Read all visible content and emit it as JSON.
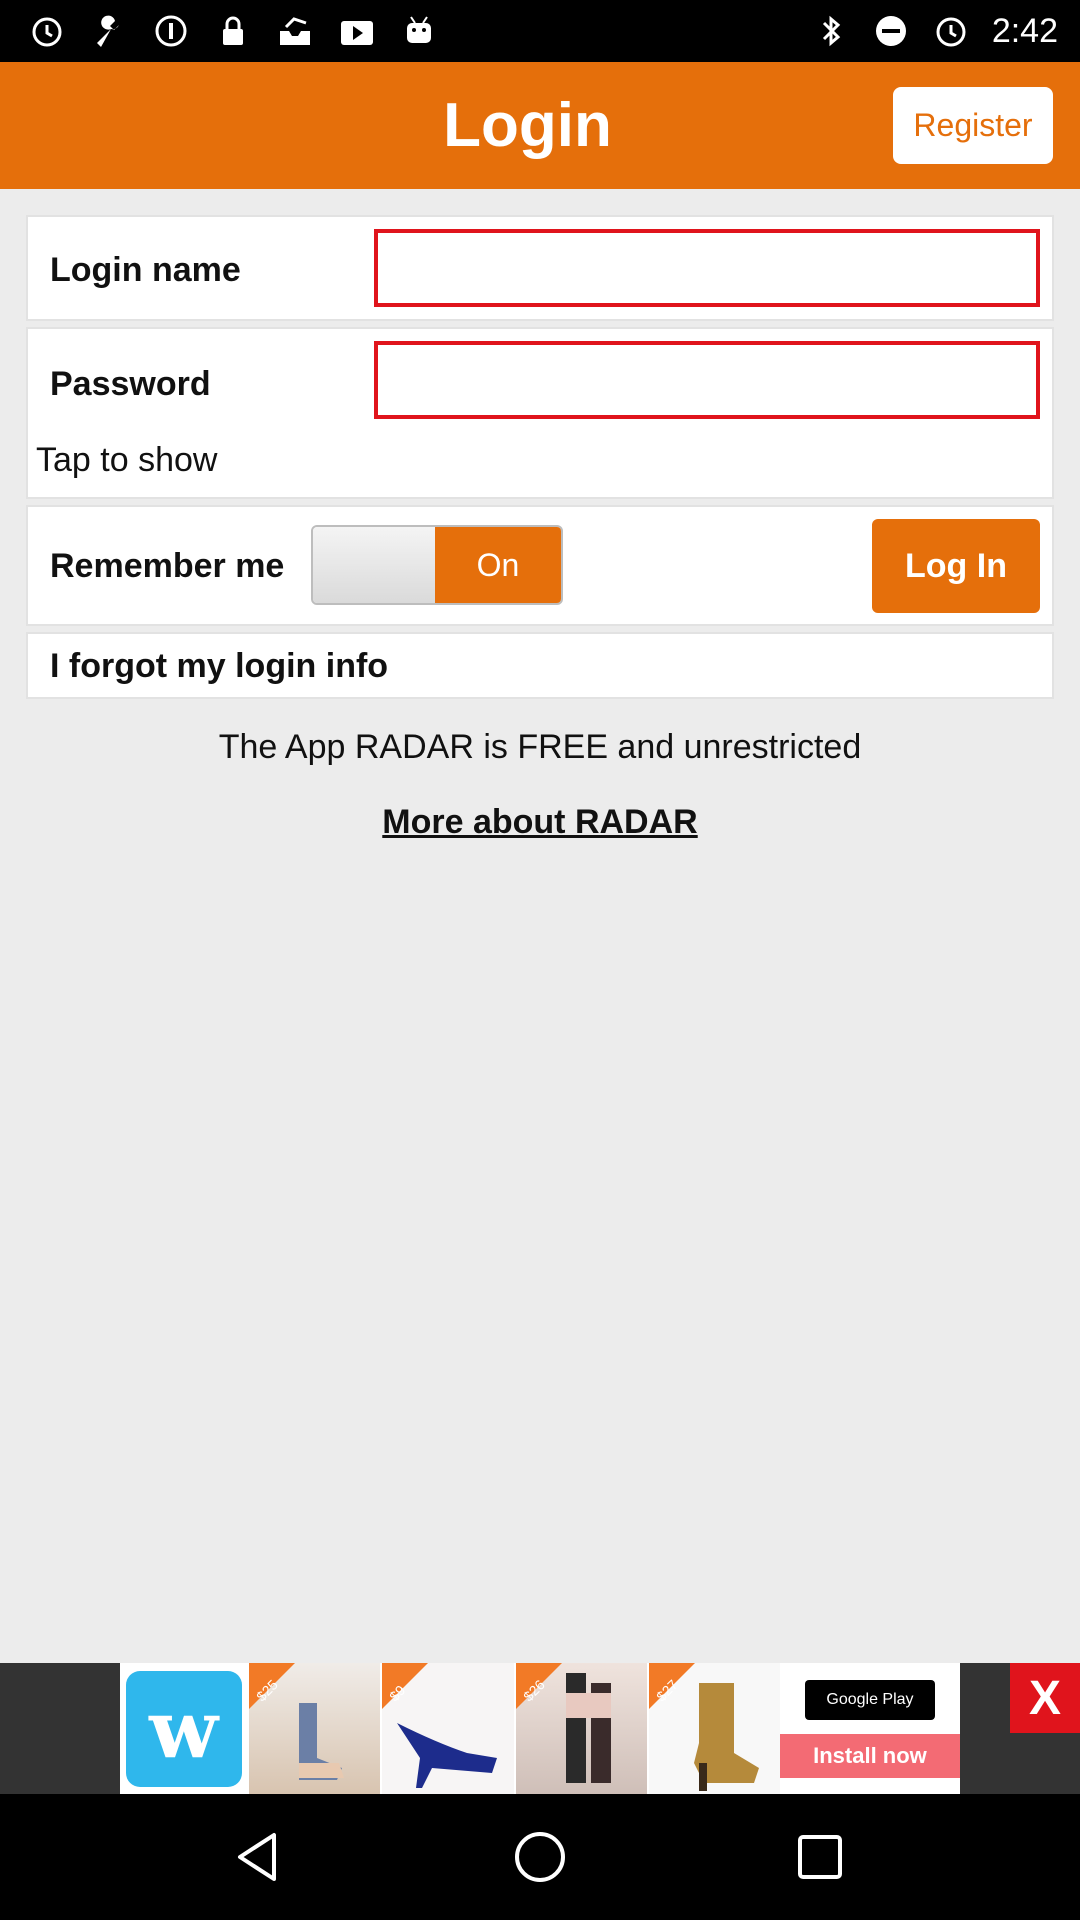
{
  "status_bar": {
    "time": "2:42",
    "left_icons": [
      "alarm-icon",
      "wrench-icon",
      "info-icon",
      "lock-icon",
      "inbox-icon",
      "play-icon",
      "android-icon"
    ],
    "right_icons": [
      "bluetooth-icon",
      "dnd-icon",
      "alarm-icon"
    ]
  },
  "app_bar": {
    "title": "Login",
    "register_label": "Register"
  },
  "form": {
    "login_name_label": "Login name",
    "login_name_value": "",
    "password_label": "Password",
    "password_value": "",
    "tap_to_show": "Tap to show",
    "remember_me_label": "Remember me",
    "remember_toggle_label": "On",
    "remember_toggle_state": "on",
    "login_button_label": "Log In",
    "forgot_label": "I forgot my login info"
  },
  "info": {
    "free_text": "The App RADAR is FREE and unrestricted",
    "more_link": "More about RADAR"
  },
  "ad": {
    "brand_letter": "w",
    "price_tags": [
      "$25",
      "$9",
      "$26",
      "$27"
    ],
    "store_badge": "Google Play",
    "cta": "Install now",
    "close_label": "X"
  },
  "colors": {
    "accent": "#e56f0b",
    "field_border": "#e0141c",
    "background": "#ececec"
  },
  "nav_bar": {
    "buttons": [
      "back-icon",
      "home-icon",
      "recents-icon"
    ]
  }
}
